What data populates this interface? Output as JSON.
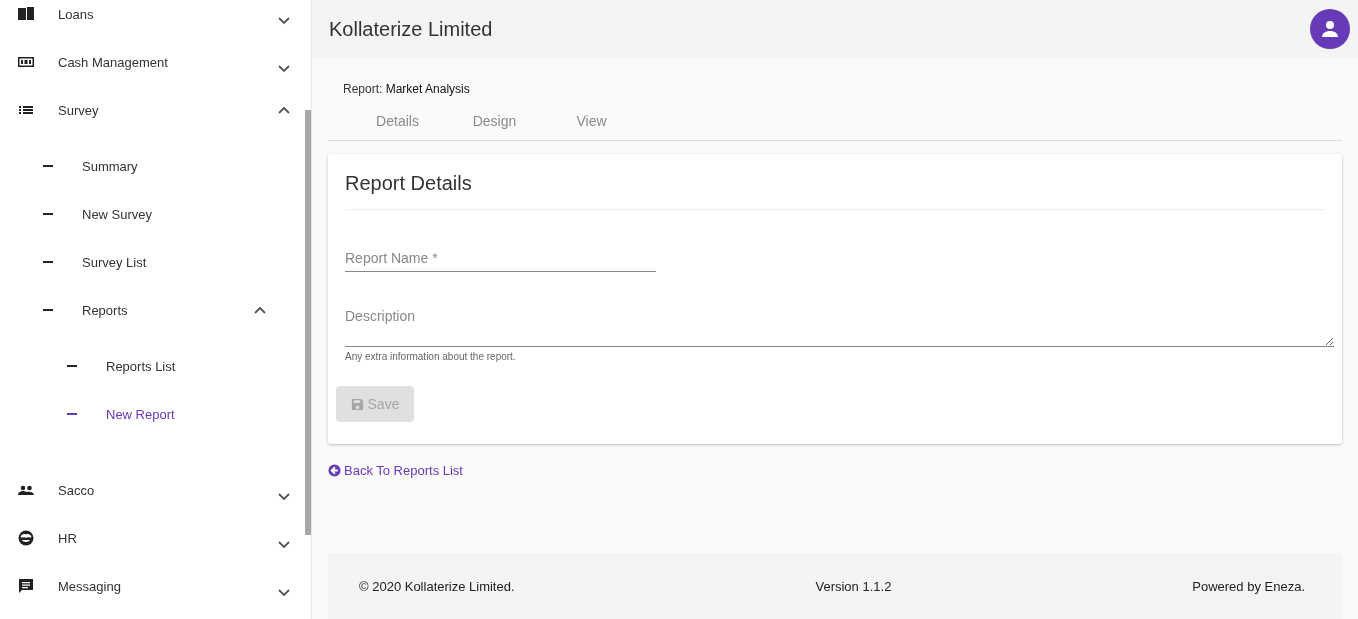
{
  "sidebar": {
    "items": [
      {
        "label": "Loans",
        "expanded": false,
        "selected": false
      },
      {
        "label": "Cash Management",
        "expanded": false,
        "selected": false
      },
      {
        "label": "Survey",
        "expanded": true,
        "selected": false,
        "children": [
          {
            "label": "Summary",
            "selected": false
          },
          {
            "label": "New Survey",
            "selected": false
          },
          {
            "label": "Survey List",
            "selected": false
          },
          {
            "label": "Reports",
            "expanded": true,
            "selected": false,
            "children": [
              {
                "label": "Reports List",
                "selected": false
              },
              {
                "label": "New Report",
                "selected": true
              }
            ]
          }
        ]
      },
      {
        "label": "Sacco",
        "expanded": false,
        "selected": false
      },
      {
        "label": "HR",
        "expanded": false,
        "selected": false
      },
      {
        "label": "Messaging",
        "expanded": false,
        "selected": false
      }
    ]
  },
  "header": {
    "title": "Kollaterize Limited"
  },
  "report": {
    "label": "Report:",
    "name": "Market Analysis"
  },
  "tabs": [
    {
      "label": "Details",
      "selected": false
    },
    {
      "label": "Design",
      "selected": false
    },
    {
      "label": "View",
      "selected": false
    }
  ],
  "card": {
    "title": "Report Details",
    "fields": [
      {
        "kind": "line",
        "placeholder": "Report Name *"
      },
      {
        "kind": "area",
        "placeholder": "Description",
        "hint": "Any extra information about the report."
      }
    ],
    "save": {
      "label": "Save",
      "disabled": true
    }
  },
  "back_link": "Back To Reports List",
  "footer": {
    "copyright": "© 2020 Kollaterize Limited.",
    "version": "Version 1.1.2",
    "powered": "Powered by Eneza."
  }
}
